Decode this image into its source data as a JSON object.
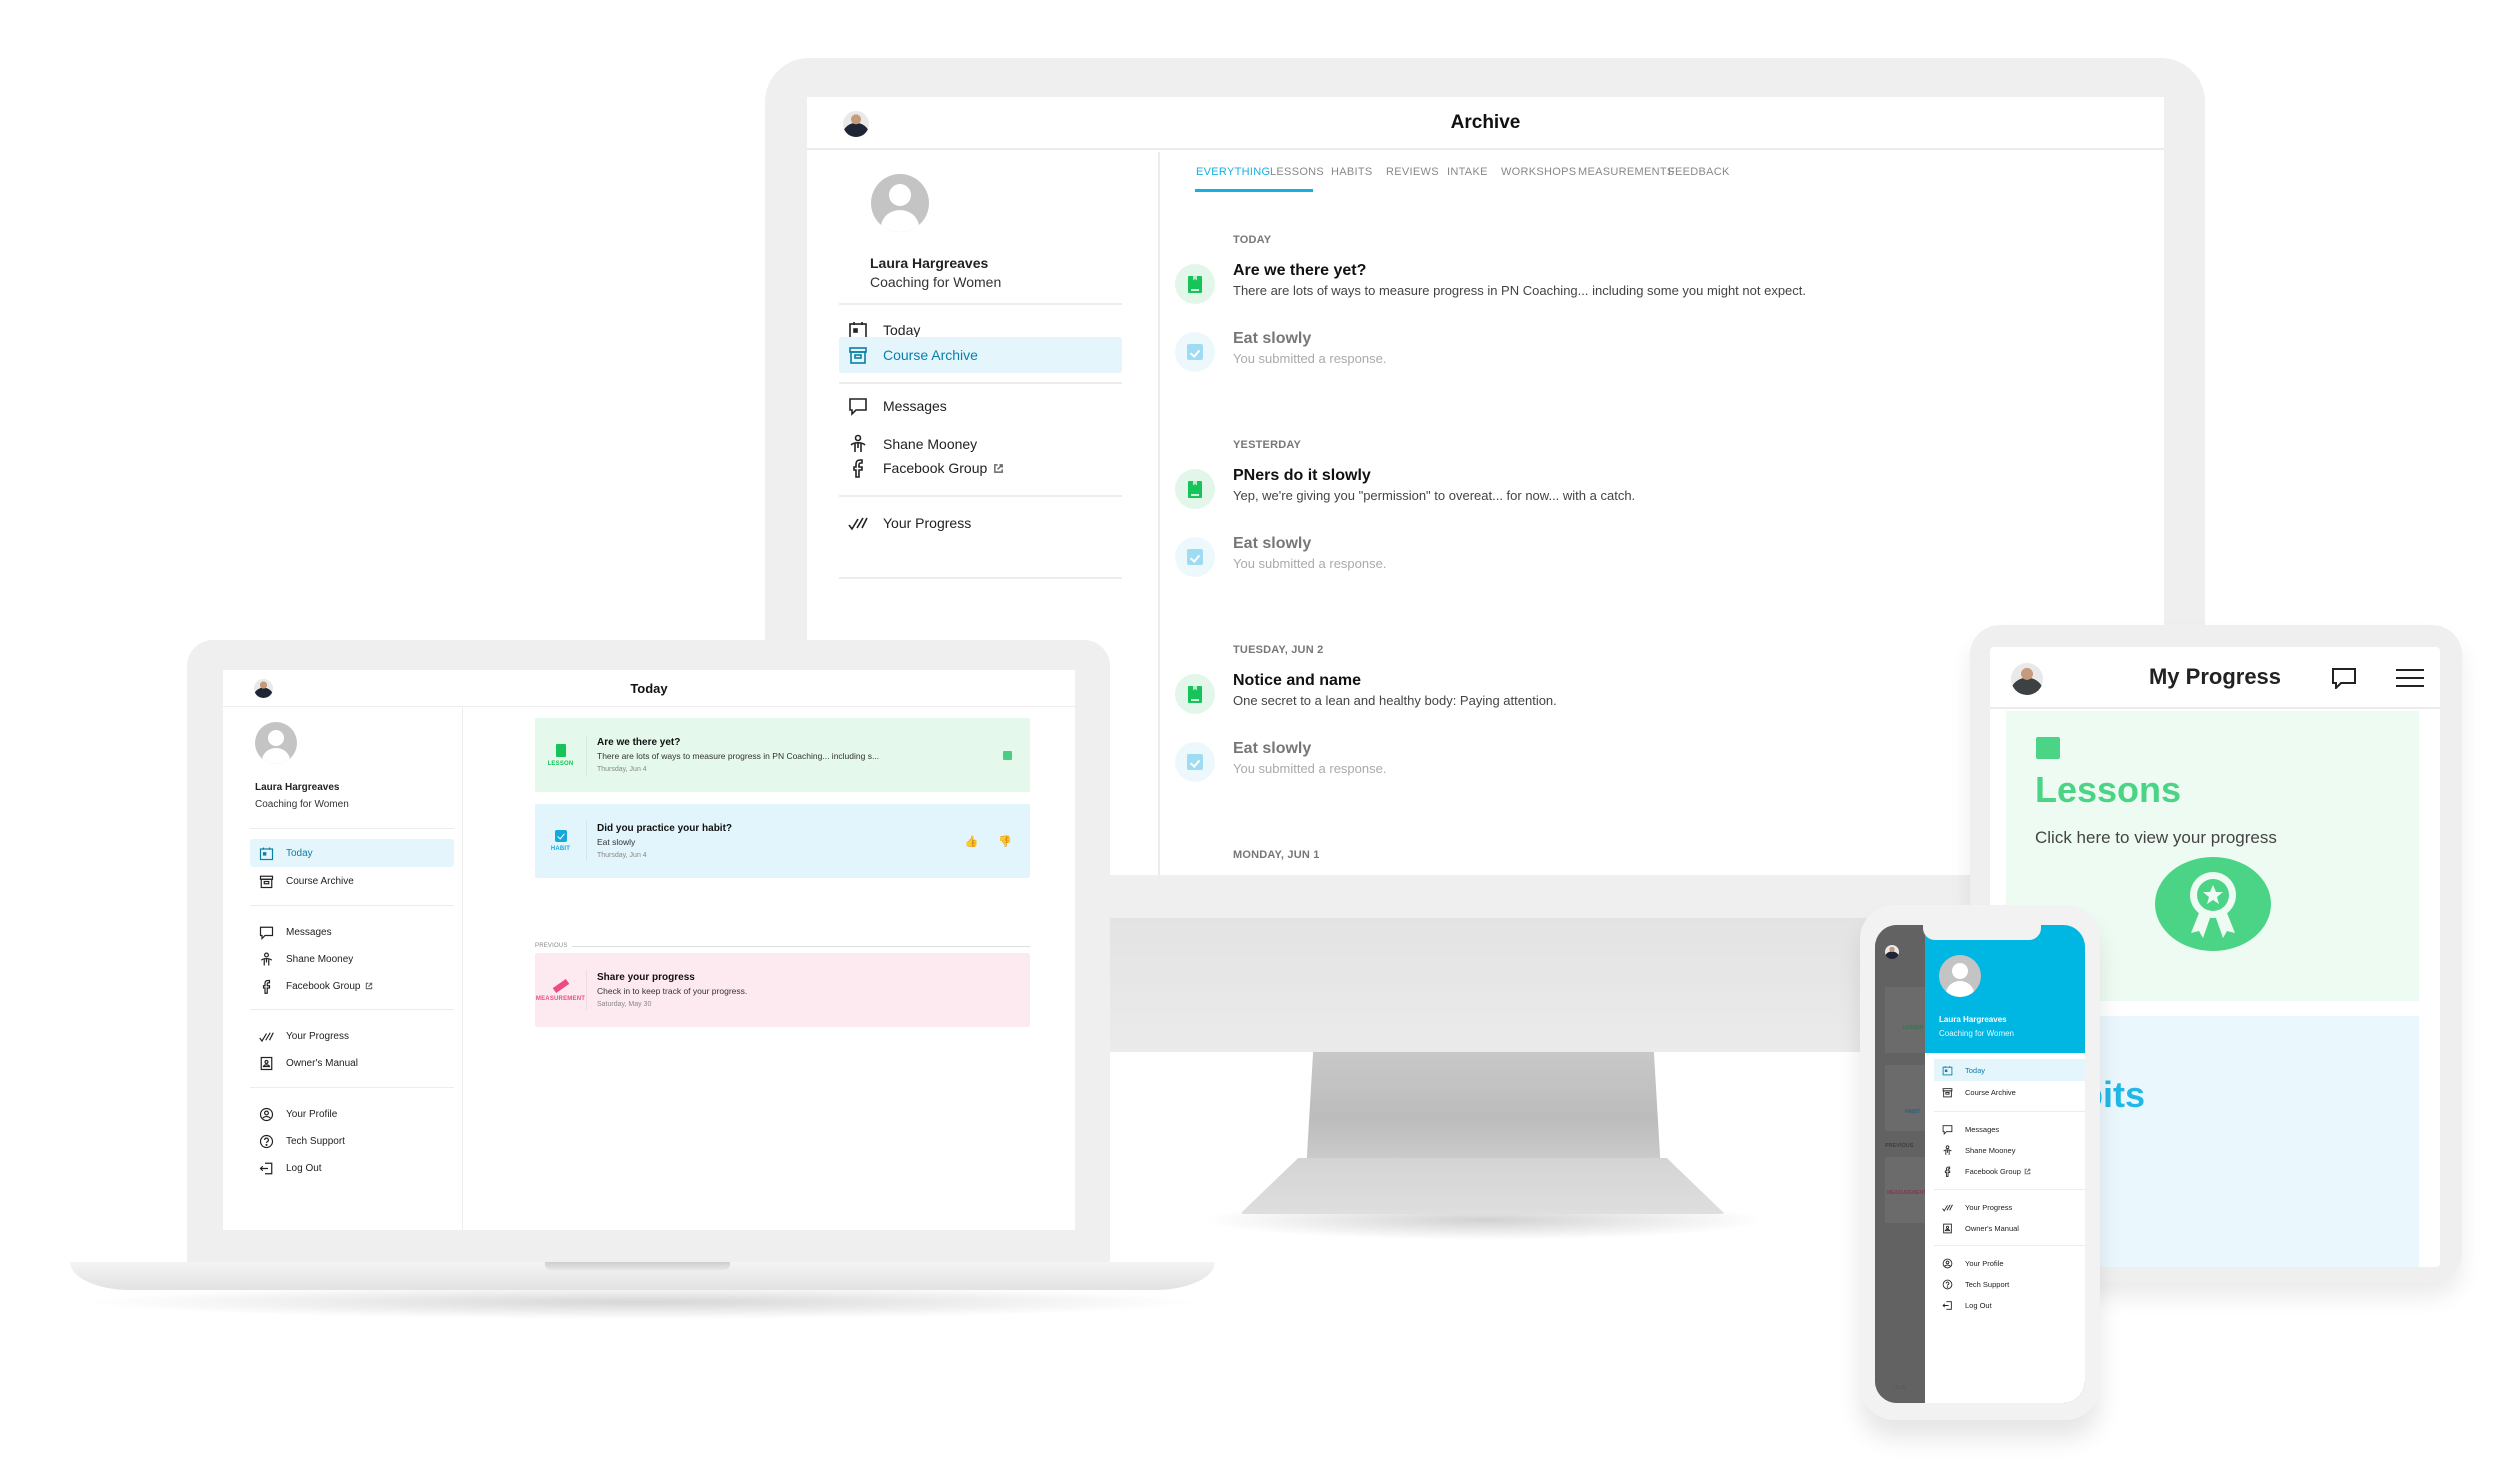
{
  "colors": {
    "accent": "#14b1e0",
    "lesson_green": "#17c45a",
    "habit_blue": "#14a9dc",
    "measurement_pink": "#ef4b82",
    "drawer_blue": "#00b6e3",
    "active_bg": "#e4f6fc"
  },
  "user": {
    "name": "Laura Hargreaves",
    "plan": "Coaching for Women"
  },
  "nav": {
    "today": "Today",
    "course_archive": "Course Archive",
    "messages": "Messages",
    "coach": "Shane Mooney",
    "facebook_group": "Facebook Group",
    "your_progress": "Your Progress",
    "owners_manual": "Owner's Manual",
    "your_profile": "Your Profile",
    "tech_support": "Tech Support",
    "log_out": "Log Out"
  },
  "desktop": {
    "title": "Archive",
    "tabs": [
      {
        "label": "Everything",
        "active": true
      },
      {
        "label": "Lessons"
      },
      {
        "label": "Habits"
      },
      {
        "label": "Reviews"
      },
      {
        "label": "Intake"
      },
      {
        "label": "Workshops"
      },
      {
        "label": "Measurements"
      },
      {
        "label": "Feedback"
      }
    ],
    "feed": [
      {
        "day": "TODAY",
        "items": [
          {
            "type": "lesson",
            "title": "Are we there yet?",
            "desc": "There are lots of ways to measure progress in PN Coaching... including some you might not expect."
          },
          {
            "type": "habit",
            "title": "Eat slowly",
            "desc": "You submitted a response."
          }
        ]
      },
      {
        "day": "YESTERDAY",
        "items": [
          {
            "type": "lesson",
            "title": "PNers do it slowly",
            "desc": "Yep, we're giving you \"permission\" to overeat... for now... with a catch."
          },
          {
            "type": "habit",
            "title": "Eat slowly",
            "desc": "You submitted a response."
          }
        ]
      },
      {
        "day": "TUESDAY, JUN 2",
        "items": [
          {
            "type": "lesson",
            "title": "Notice and name",
            "desc": "One secret to a lean and healthy body: Paying attention."
          },
          {
            "type": "habit",
            "title": "Eat slowly",
            "desc": "You submitted a response."
          }
        ]
      },
      {
        "day": "MONDAY, JUN 1",
        "items": []
      }
    ]
  },
  "laptop": {
    "title": "Today",
    "previous_label": "PREVIOUS",
    "cards": [
      {
        "type": "lesson",
        "type_label": "LESSON",
        "title": "Are we there yet?",
        "desc": "There are lots of ways to measure progress in PN Coaching... including s...",
        "date": "Thursday, Jun 4"
      },
      {
        "type": "habit",
        "type_label": "HABIT",
        "title": "Did you practice your habit?",
        "desc": "Eat slowly",
        "date": "Thursday, Jun 4"
      },
      {
        "type": "measurement",
        "type_label": "MEASUREMENT",
        "title": "Share your progress",
        "desc": "Check in to keep track of your progress.",
        "date": "Saturday, May 30"
      }
    ]
  },
  "tablet": {
    "title": "My Progress",
    "lessons_heading": "Lessons",
    "lessons_sub": "Click here to view your progress",
    "habits_heading": "Habits"
  },
  "phone": {
    "behind_labels": {
      "lesson": "LESSON",
      "habit": "HABIT",
      "previous": "PREVIOUS",
      "measurement": "MEASUREMENT",
      "footer": "© 20"
    }
  }
}
